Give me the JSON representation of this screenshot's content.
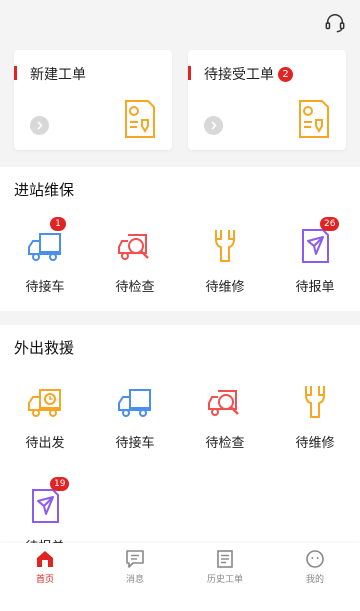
{
  "header": {
    "support_icon": "headset-icon"
  },
  "cards": [
    {
      "title": "新建工单",
      "badge": ""
    },
    {
      "title": "待接受工单",
      "badge": "2"
    }
  ],
  "section_station": {
    "title": "进站维保",
    "items": [
      {
        "label": "待接车",
        "badge": "1",
        "icon": "truck-icon"
      },
      {
        "label": "待检查",
        "badge": "",
        "icon": "inspect-icon"
      },
      {
        "label": "待维修",
        "badge": "",
        "icon": "wrench-icon"
      },
      {
        "label": "待报单",
        "badge": "26",
        "icon": "report-icon"
      }
    ]
  },
  "section_rescue": {
    "title": "外出救援",
    "items": [
      {
        "label": "待出发",
        "badge": "",
        "icon": "depart-truck-icon"
      },
      {
        "label": "待接车",
        "badge": "",
        "icon": "truck-icon"
      },
      {
        "label": "待检查",
        "badge": "",
        "icon": "inspect-icon"
      },
      {
        "label": "待维修",
        "badge": "",
        "icon": "wrench-icon"
      },
      {
        "label": "待报单",
        "badge": "19",
        "icon": "report-icon"
      }
    ]
  },
  "tabs": [
    {
      "label": "首页",
      "icon": "home-icon",
      "active": true
    },
    {
      "label": "消息",
      "icon": "message-icon",
      "active": false
    },
    {
      "label": "历史工单",
      "icon": "history-icon",
      "active": false
    },
    {
      "label": "我的",
      "icon": "profile-icon",
      "active": false
    }
  ],
  "colors": {
    "accent": "#e02424",
    "blue": "#4a8ef0",
    "orange": "#f5a623",
    "red": "#f05050",
    "purple": "#8a5cf0"
  }
}
